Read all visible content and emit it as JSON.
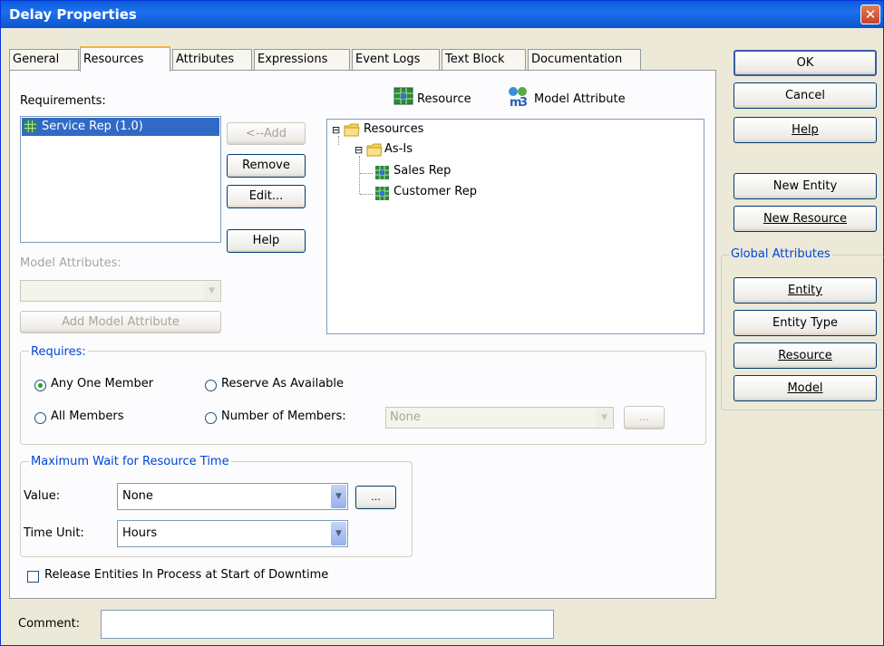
{
  "window": {
    "title": "Delay Properties",
    "close_glyph": "✕"
  },
  "tabs": [
    {
      "label": "General"
    },
    {
      "label": "Resources"
    },
    {
      "label": "Attributes"
    },
    {
      "label": "Expressions"
    },
    {
      "label": "Event Logs"
    },
    {
      "label": "Text Block"
    },
    {
      "label": "Documentation"
    }
  ],
  "active_tab": "Resources",
  "requirements": {
    "label": "Requirements:",
    "items": [
      "Service Rep (1.0)"
    ],
    "selected": "Service Rep (1.0)"
  },
  "buttons": {
    "add": "<--Add",
    "remove": "Remove",
    "edit": "Edit...",
    "help": "Help"
  },
  "legend": {
    "resource": "Resource",
    "model_attribute": "Model Attribute"
  },
  "tree": {
    "root": "Resources",
    "folder": "As-Is",
    "items": [
      "Sales Rep",
      "Customer Rep"
    ],
    "expander": "⊟"
  },
  "model_attributes": {
    "label": "Model Attributes:",
    "value": "",
    "add_button": "Add Model Attribute"
  },
  "requires": {
    "title": "Requires:",
    "options": {
      "any_one": "Any One Member",
      "reserve": "Reserve As Available",
      "all": "All Members",
      "number": "Number of Members:"
    },
    "selected": "Any One Member",
    "number_value": "None",
    "ellipsis": "..."
  },
  "max_wait": {
    "title": "Maximum Wait for Resource Time",
    "value_label": "Value:",
    "value": "None",
    "ellipsis": "...",
    "time_unit_label": "Time Unit:",
    "time_unit": "Hours"
  },
  "release_checkbox": {
    "label": "Release Entities In Process at Start of Downtime",
    "checked": false
  },
  "comment": {
    "label": "Comment:",
    "value": ""
  },
  "side": {
    "ok": "OK",
    "cancel": "Cancel",
    "help": "Help",
    "new_entity": "New Entity",
    "new_resource": "New Resource",
    "global_title": "Global Attributes",
    "entity": "Entity",
    "entity_type": "Entity Type",
    "resource": "Resource",
    "model": "Model"
  },
  "colors": {
    "titlebar": "#0a5fd8",
    "selection": "#316ac5",
    "group_title": "#0046d5"
  }
}
